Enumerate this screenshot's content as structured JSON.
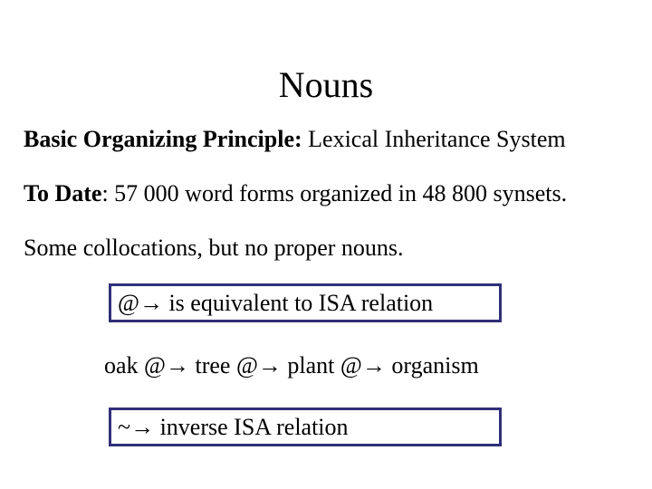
{
  "slide": {
    "title": "Nouns",
    "principle": {
      "label": "Basic Organizing Principle:",
      "value": " Lexical Inheritance System"
    },
    "to_date": {
      "label": "To Date",
      "colon": ":",
      "value": " 57 000 word forms organized in 48 800 synsets."
    },
    "collocations": "Some collocations, but no proper nouns.",
    "box_isa": {
      "symbol": "@→",
      "text": " is equivalent to ISA relation"
    },
    "chain": [
      {
        "word": "oak",
        "arrow": " @→ "
      },
      {
        "word": "tree",
        "arrow": " @→ "
      },
      {
        "word": "plant",
        "arrow": " @→ "
      },
      {
        "word": "organism",
        "arrow": ""
      }
    ],
    "box_inverse": {
      "symbol": "~→",
      "text": " inverse ISA relation"
    },
    "colors": {
      "box_border": "#303078",
      "text": "#000000",
      "background": "#ffffff"
    }
  }
}
